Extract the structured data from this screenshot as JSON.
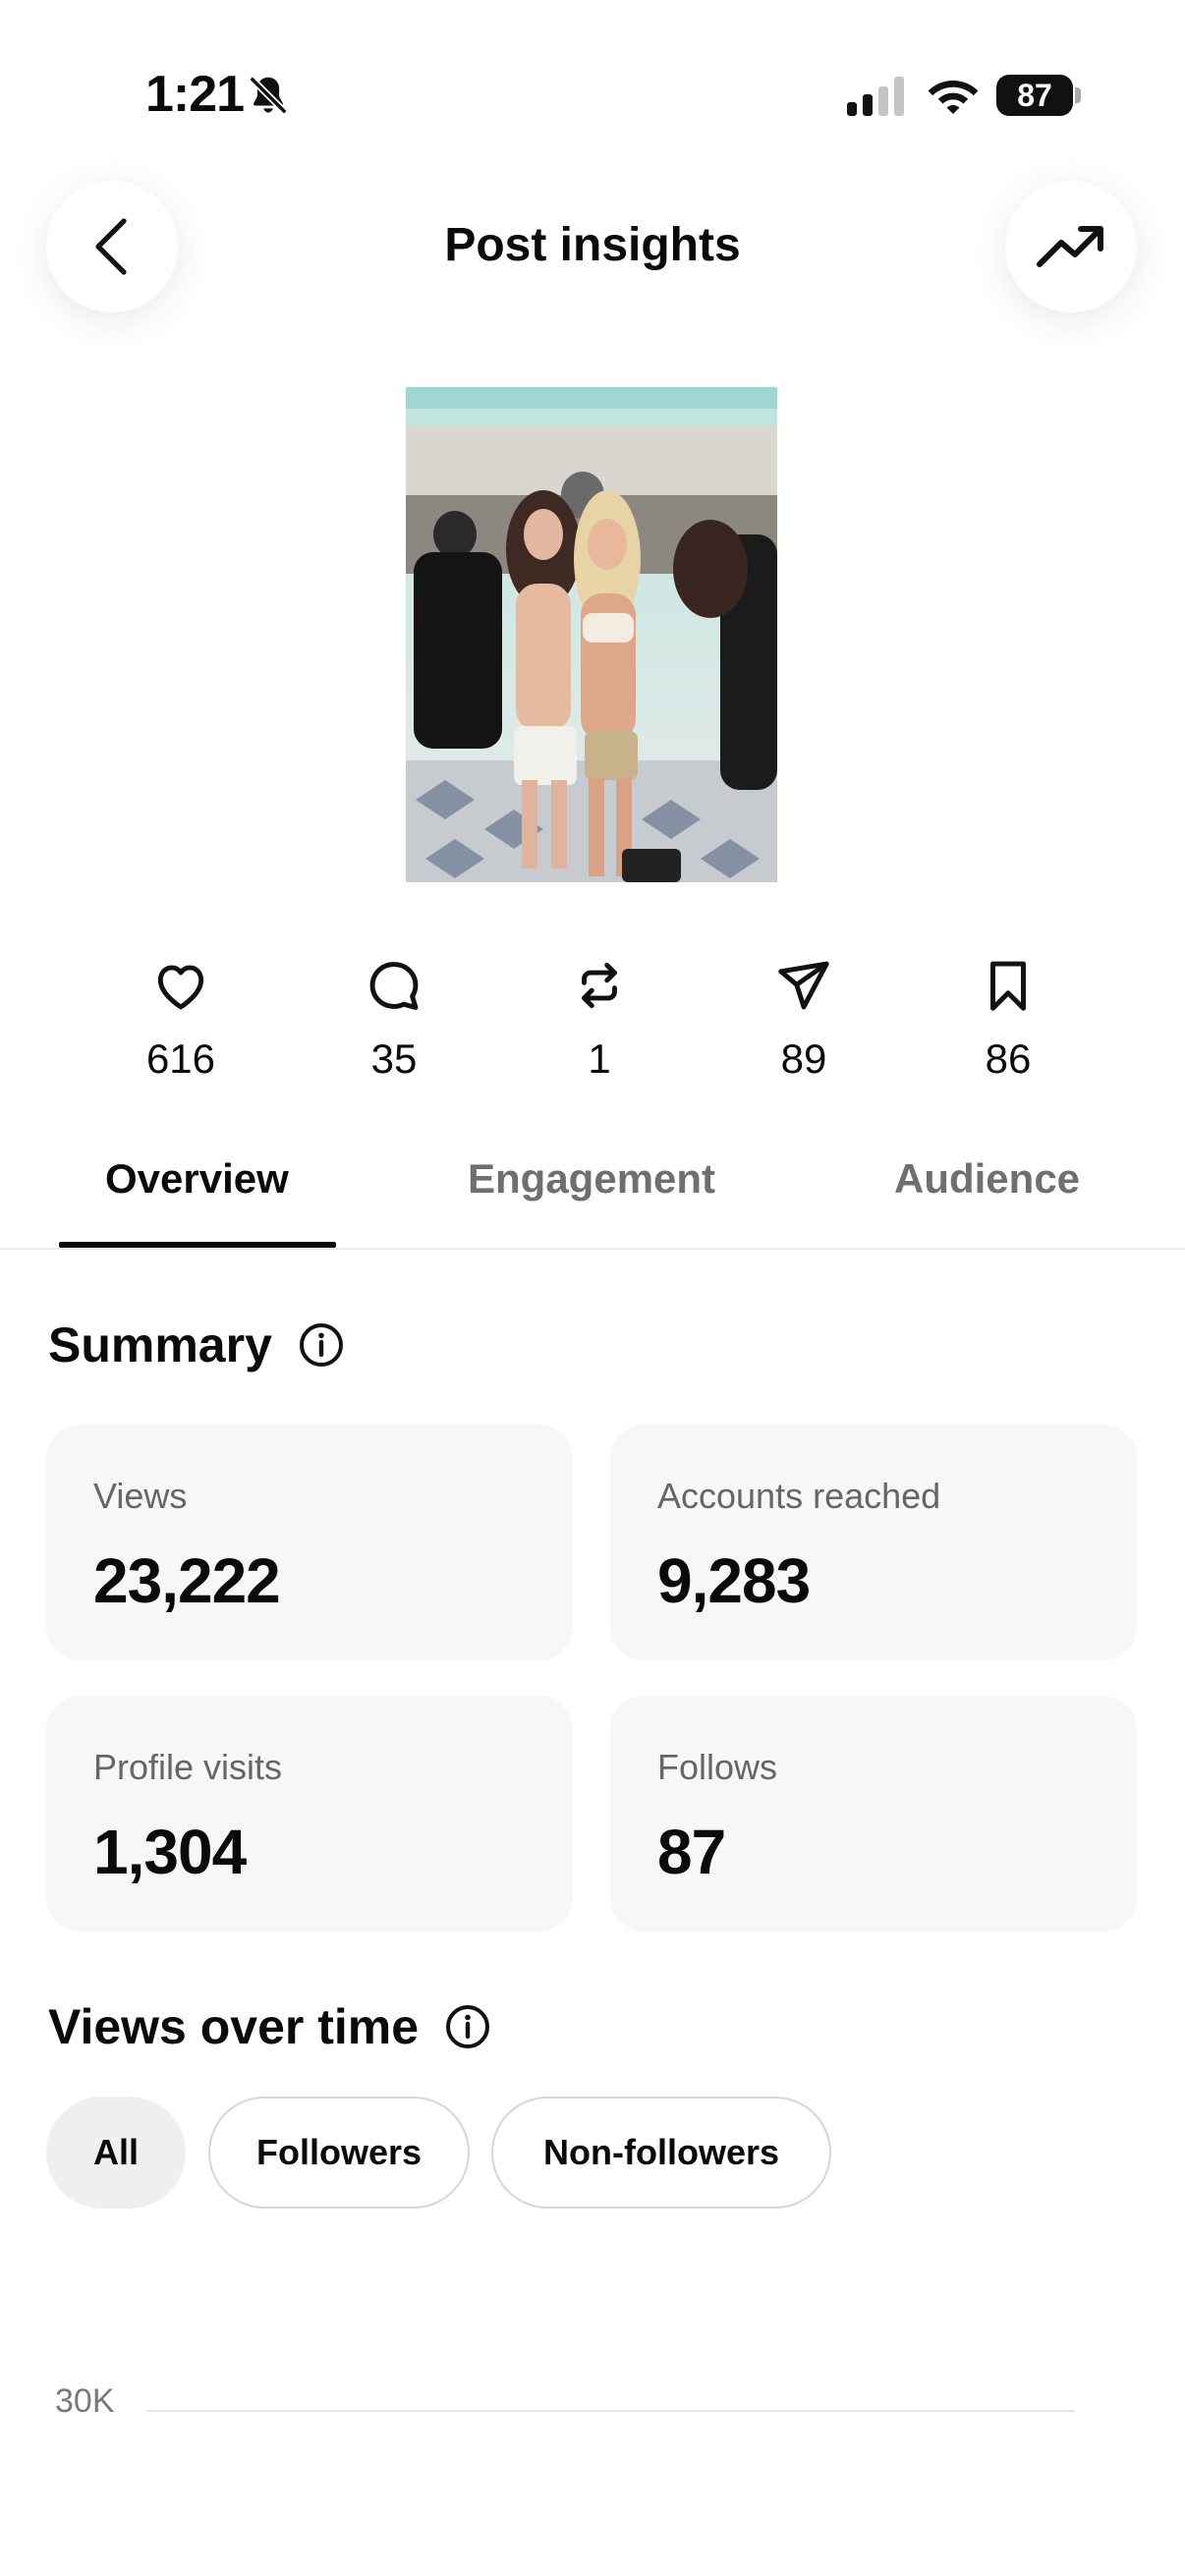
{
  "status_bar": {
    "time": "1:21",
    "battery": "87"
  },
  "header": {
    "title": "Post insights"
  },
  "stats": [
    {
      "icon": "heart-icon",
      "value": "616"
    },
    {
      "icon": "comment-icon",
      "value": "35"
    },
    {
      "icon": "repost-icon",
      "value": "1"
    },
    {
      "icon": "share-icon",
      "value": "89"
    },
    {
      "icon": "bookmark-icon",
      "value": "86"
    }
  ],
  "tabs": {
    "overview": "Overview",
    "engagement": "Engagement",
    "audience": "Audience",
    "active": "Overview"
  },
  "summary": {
    "title": "Summary",
    "cards": [
      {
        "label": "Views",
        "value": "23,222"
      },
      {
        "label": "Accounts reached",
        "value": "9,283"
      },
      {
        "label": "Profile visits",
        "value": "1,304"
      },
      {
        "label": "Follows",
        "value": "87"
      }
    ]
  },
  "views_over_time": {
    "title": "Views over time",
    "filters": [
      "All",
      "Followers",
      "Non-followers"
    ],
    "selected_filter": "All"
  },
  "chart_data": {
    "type": "line",
    "title": "",
    "xlabel": "",
    "ylabel": "",
    "y_ticks": [
      "30K"
    ],
    "series": []
  },
  "colors": {
    "text": "#0a0a0a",
    "muted": "#666666",
    "card_bg": "#f6f7f7",
    "chip_selected_bg": "#eef0f0"
  }
}
